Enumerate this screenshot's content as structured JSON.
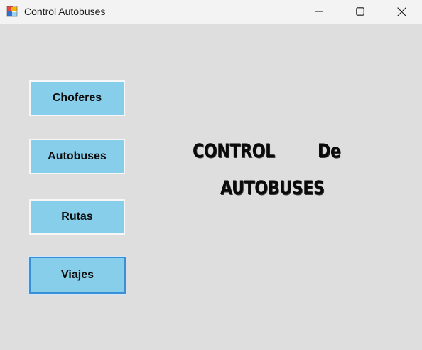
{
  "window": {
    "title": "Control Autobuses"
  },
  "nav": {
    "choferes_label": "Choferes",
    "autobuses_label": "Autobuses",
    "rutas_label": "Rutas",
    "viajes_label": "Viajes"
  },
  "heading": {
    "word1": "CONTROL",
    "word2": "De",
    "word3": "AUTOBUSES"
  },
  "colors": {
    "button_fill": "#87ceeb",
    "client_background": "#dedede",
    "titlebar_background": "#f3f3f3",
    "focus_border": "#3b8fd6"
  },
  "icons": {
    "app": "app-icon",
    "minimize": "minimize-icon",
    "maximize": "maximize-icon",
    "close": "close-icon"
  }
}
